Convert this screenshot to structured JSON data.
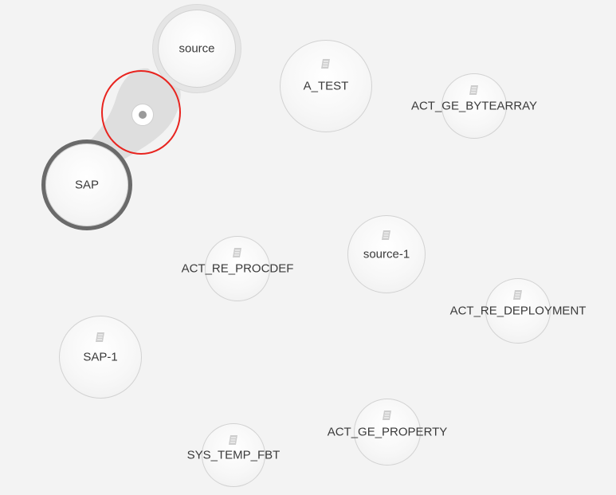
{
  "graph": {
    "nodes": {
      "source": {
        "label": "source",
        "icon": "none"
      },
      "sap": {
        "label": "SAP",
        "icon": "none"
      },
      "a_test": {
        "label": "A_TEST",
        "icon": "table-scroll-icon"
      },
      "act_ge_bytearray": {
        "label": "ACT_GE_BYTEARRAY",
        "icon": "table-scroll-icon"
      },
      "act_re_procdef": {
        "label": "ACT_RE_PROCDEF",
        "icon": "table-scroll-icon"
      },
      "source_1": {
        "label": "source-1",
        "icon": "table-scroll-icon"
      },
      "act_re_deployment": {
        "label": "ACT_RE_DEPLOYMENT",
        "icon": "table-scroll-icon"
      },
      "sap_1": {
        "label": "SAP-1",
        "icon": "table-scroll-icon"
      },
      "act_ge_property": {
        "label": "ACT_GE_PROPERTY",
        "icon": "table-scroll-icon"
      },
      "sys_temp_fbt": {
        "label": "SYS_TEMP_FBT",
        "icon": "table-scroll-icon"
      }
    },
    "selected_node": "SAP",
    "link": {
      "from": "source",
      "to": "SAP"
    },
    "colors": {
      "background": "#f3f3f3",
      "selection_ring": "#6a6a6a",
      "highlight_annotation": "#e8241f",
      "link_band": "#dedede"
    }
  }
}
